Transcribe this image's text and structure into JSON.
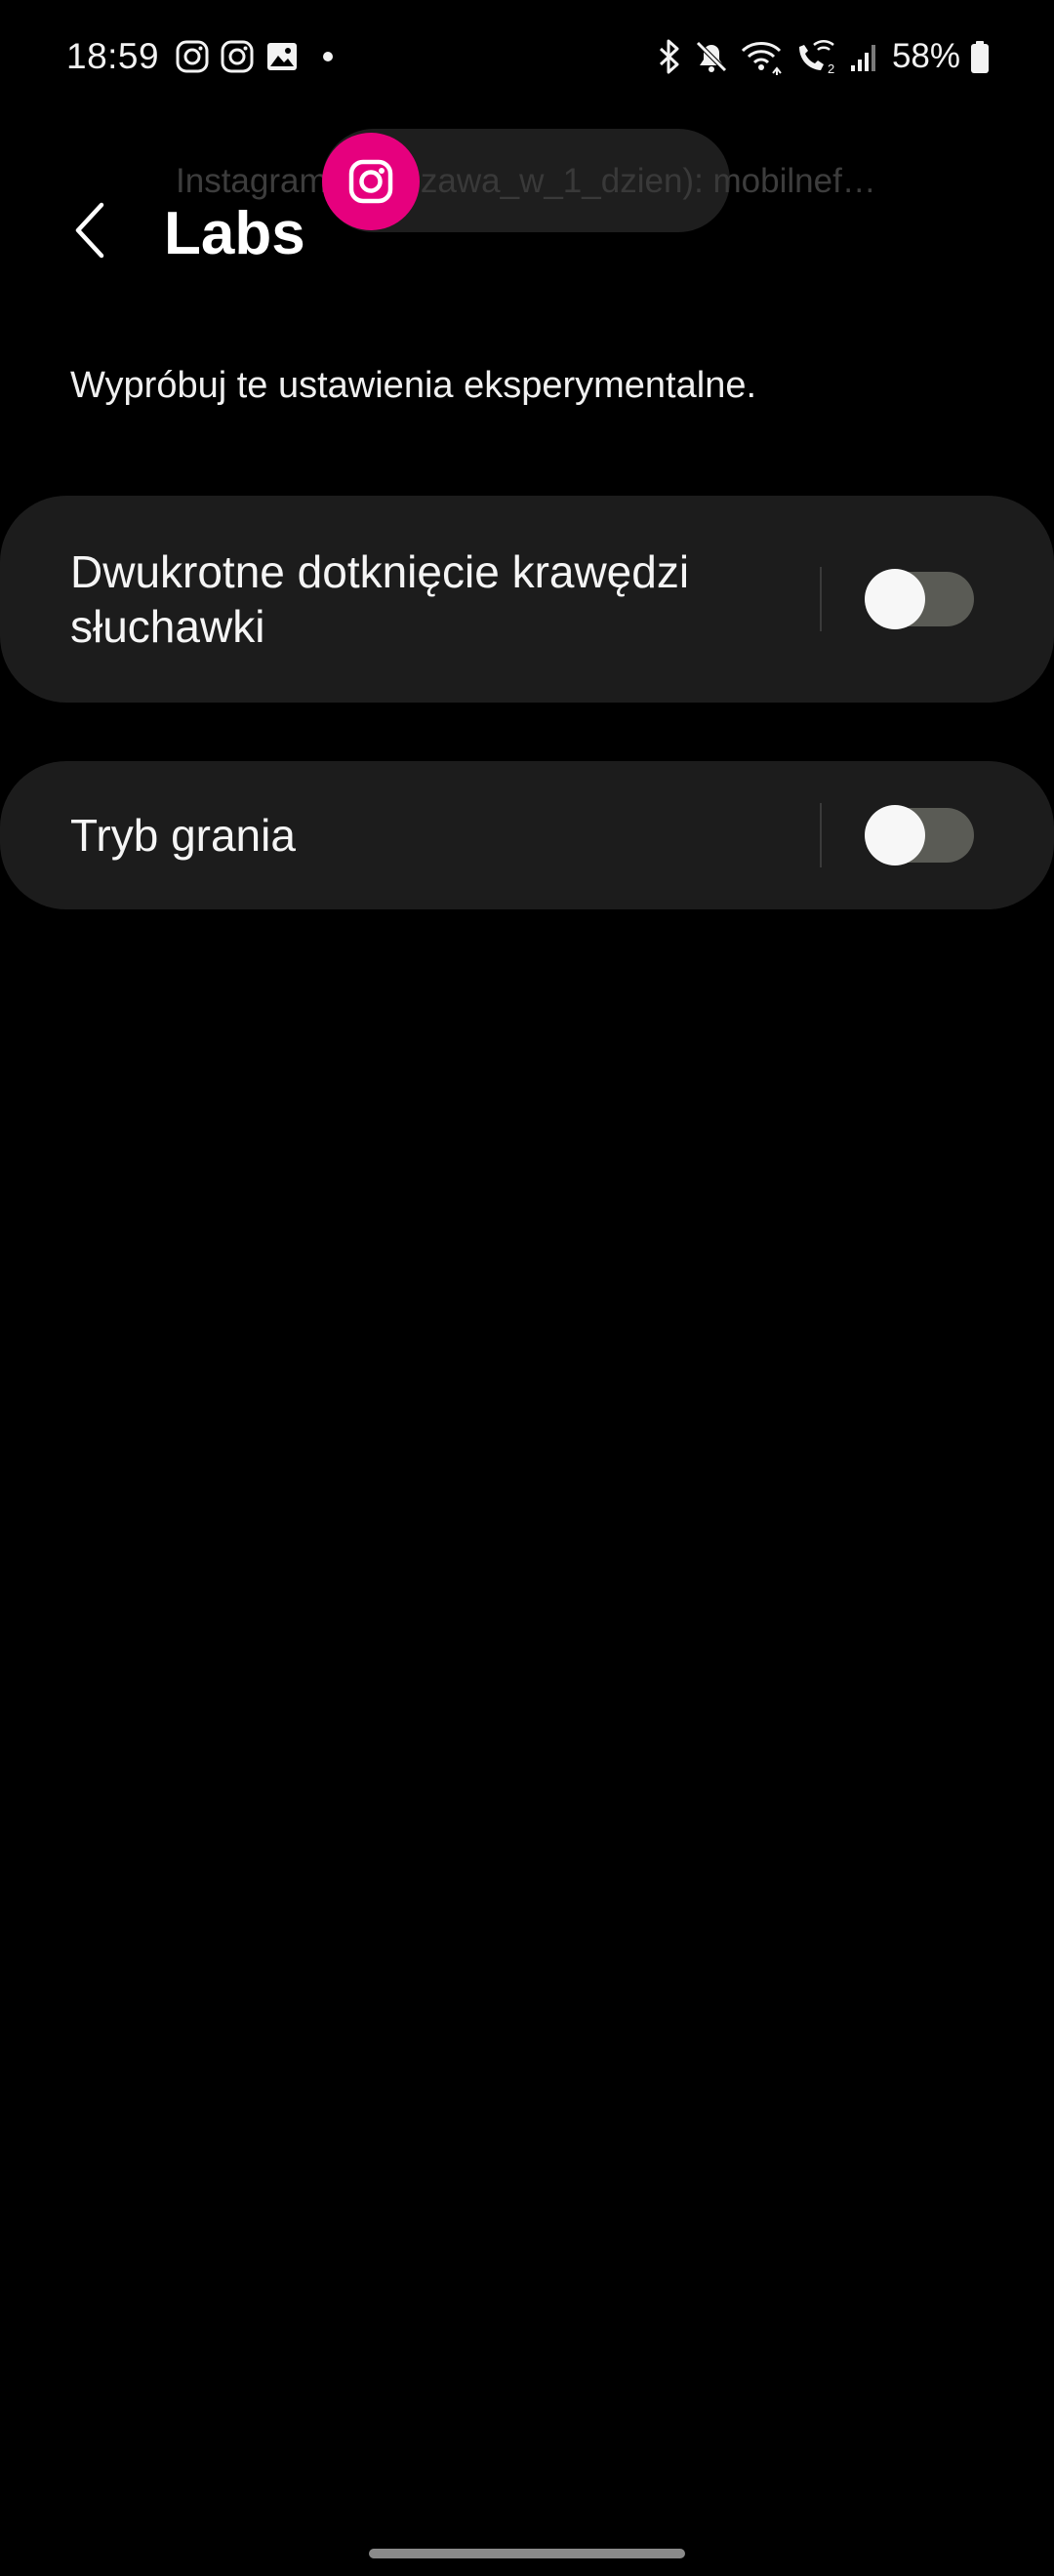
{
  "status_bar": {
    "time": "18:59",
    "left_icons": [
      "instagram-icon",
      "instagram-icon",
      "gallery-icon",
      "notification-dot-icon"
    ],
    "right_icons": [
      "bluetooth-icon",
      "mute-icon",
      "wifi-icon",
      "wifi-calling-icon",
      "signal-icon",
      "battery-icon"
    ],
    "battery": "58%"
  },
  "notification": {
    "ticker_text": "Instagram (warszawa_w_1_dzien): mobilnef…",
    "app_icon": "instagram-icon",
    "accent_color": "#e6007e"
  },
  "header": {
    "back_icon": "chevron-left-icon",
    "title": "Labs"
  },
  "description": "Wypróbuj te ustawienia eksperymentalne.",
  "settings": [
    {
      "label": "Dwukrotne dotknięcie krawędzi słuchawki",
      "enabled": false
    },
    {
      "label": "Tryb grania",
      "enabled": false
    }
  ],
  "colors": {
    "background": "#000000",
    "card": "#1c1c1c",
    "toggle_off_track": "#5a5b55",
    "toggle_knob": "#f7f7f7"
  }
}
